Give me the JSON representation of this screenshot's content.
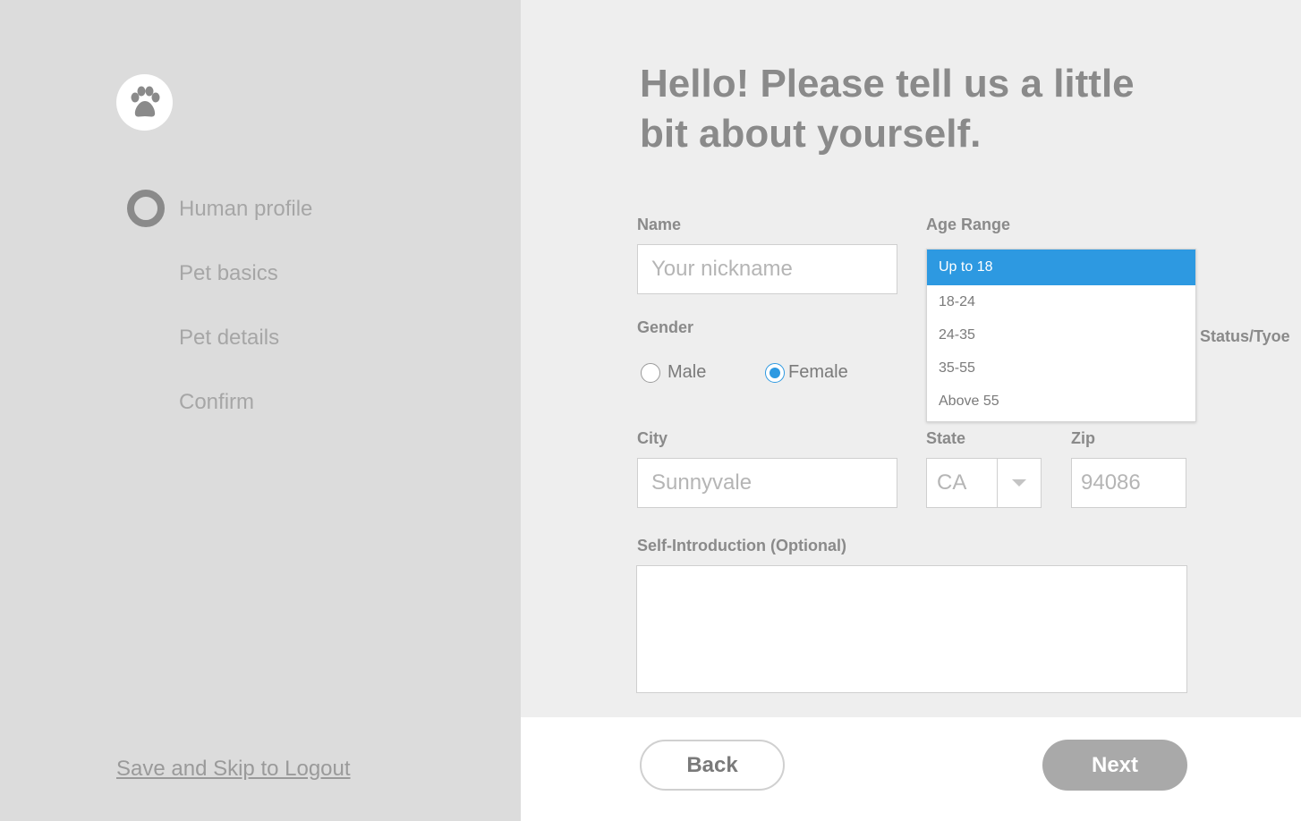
{
  "sidebar": {
    "steps": [
      {
        "label": "Human profile"
      },
      {
        "label": "Pet basics"
      },
      {
        "label": "Pet details"
      },
      {
        "label": "Confirm"
      }
    ],
    "skip_link": "Save and Skip to Logout"
  },
  "main": {
    "heading": "Hello! Please tell us a little bit about yourself.",
    "name": {
      "label": "Name",
      "placeholder": "Your nickname",
      "value": ""
    },
    "age_range": {
      "label": "Age Range",
      "options": [
        "Up to 18",
        "18-24",
        "24-35",
        "35-55",
        "Above 55"
      ],
      "selected": "Up to 18"
    },
    "gender": {
      "label": "Gender",
      "options": [
        {
          "label": "Male",
          "checked": false
        },
        {
          "label": "Female",
          "checked": true
        }
      ]
    },
    "job_status": {
      "label": "Job Status/Tyoe"
    },
    "city": {
      "label": "City",
      "placeholder": "Sunnyvale"
    },
    "state": {
      "label": "State",
      "value": "CA"
    },
    "zip": {
      "label": "Zip",
      "placeholder": "94086"
    },
    "self_intro": {
      "label": "Self-Introduction (Optional)",
      "value": ""
    }
  },
  "footer": {
    "back_label": "Back",
    "next_label": "Next"
  },
  "colors": {
    "accent": "#2d99e1",
    "sidebar_bg": "#dcdcdc",
    "main_bg": "#eeeeee",
    "next_button": "#a9a9a9"
  },
  "icons": {
    "logo": "paw-icon",
    "state_select": "chevron-down-icon"
  }
}
